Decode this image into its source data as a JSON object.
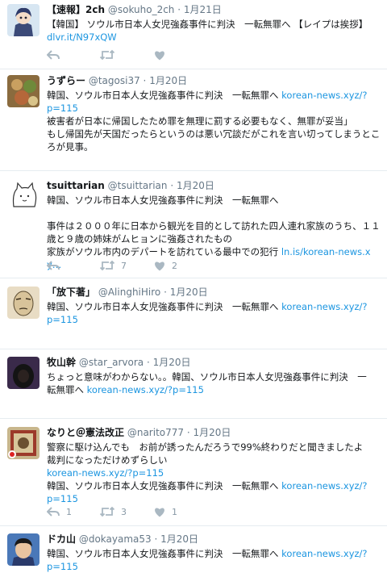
{
  "tweets": [
    {
      "name": "【速報】2ch",
      "handle": "@sokuho_2ch",
      "dot": "·",
      "date": "1月21日",
      "line1": "【韓国】 ソウル市日本人女児強姦事件に判決　一転無罪へ 【レイプは挨拶】",
      "link": "dlvr.it/N97xQW",
      "reply_count": "",
      "retweet_count": "",
      "like_count": ""
    },
    {
      "name": "うずらー",
      "handle": "@tagosi37",
      "dot": "·",
      "date": "1月20日",
      "line1": "韓国、ソウル市日本人女児強姦事件に判決　一転無罪へ",
      "link1": "korean-news.xyz/?",
      "link2": "p=115",
      "line3": "被害者が日本に帰国したため罪を無理に罰する必要もなく、無罪が妥当」",
      "line4": "もし帰国先が天国だったらというのは悪い冗談だがこれを言い切ってしまうところが見事。",
      "reply_count": "",
      "retweet_count": "",
      "like_count": ""
    },
    {
      "name": "tsuittarian",
      "handle": "@tsuittarian",
      "dot": "·",
      "date": "1月20日",
      "line1": "韓国、ソウル市日本人女児強姦事件に判決　一転無罪へ",
      "para": "事件は２０００年に日本から観光を目的として訪れた四人連れ家族のうち、１１歳と９歳の姉妹がムヒョンに強姦されたもの",
      "line_last": "家族がソウル市内のデパートを訪れている最中での犯行",
      "link": "ln.is/korean-news.xy…",
      "reply_count": "",
      "retweet_count": "7",
      "like_count": "2"
    },
    {
      "name": "「放下著」",
      "handle": "@AlinghiHiro",
      "dot": "·",
      "date": "1月20日",
      "line1": "韓国、ソウル市日本人女児強姦事件に判決　一転無罪へ",
      "link1": "korean-news.xyz/?",
      "link2": "p=115",
      "reply_count": "",
      "retweet_count": "",
      "like_count": ""
    },
    {
      "name": "牧山幹",
      "handle": "@star_arvora",
      "dot": "·",
      "date": "1月20日",
      "line1": "ちょっと意味がわからない。。韓国、ソウル市日本人女児強姦事件に判決　一",
      "line2": "転無罪へ",
      "link": "korean-news.xyz/?p=115",
      "reply_count": "",
      "retweet_count": "",
      "like_count": ""
    },
    {
      "name": "なりと＠憲法改正",
      "handle": "@narito777",
      "dot": "·",
      "date": "1月20日",
      "line1": "警察に駆け込んでも　お前が誘ったんだろうで99%終わりだと聞きましたよ",
      "line2": "裁判になっただけめずらしい",
      "link_a": "korean-news.xyz/?p=115",
      "line4": "韓国、ソウル市日本人女児強姦事件に判決　一転無罪へ",
      "link1": "korean-news.xyz/?",
      "link2": "p=115",
      "reply_count": "1",
      "retweet_count": "3",
      "like_count": "1"
    },
    {
      "name": "ドカ山",
      "handle": "@dokayama53",
      "dot": "·",
      "date": "1月20日",
      "line1": "韓国、ソウル市日本人女児強姦事件に判決　一転無罪へ",
      "link1": "korean-news.xyz/?",
      "link2": "p=115"
    }
  ],
  "colors": {
    "link": "#1b95e0",
    "meta": "#657786",
    "icon": "#aab8c2",
    "divider": "#e6ecf0"
  },
  "icons": [
    "reply-icon",
    "retweet-icon",
    "like-icon"
  ]
}
